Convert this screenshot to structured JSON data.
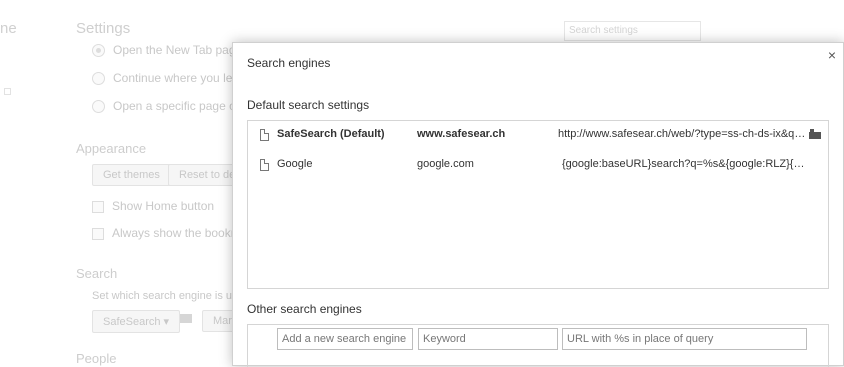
{
  "background": {
    "partial_left_text": "ne",
    "settings_heading": "Settings",
    "search_placeholder": "Search settings",
    "startup_options": [
      "Open the New Tab page",
      "Continue where you left o",
      "Open a specific page or se"
    ],
    "appearance_heading": "Appearance",
    "get_themes_label": "Get themes",
    "reset_label": "Reset to de",
    "show_home_label": "Show Home button",
    "bookmarks_label": "Always show the bookmar",
    "search_heading": "Search",
    "search_desc": "Set which search engine is use",
    "engine_select": "SafeSearch",
    "manage_label": "Mar",
    "people_heading": "People"
  },
  "dialog": {
    "title": "Search engines",
    "close_symbol": "×",
    "default_heading": "Default search settings",
    "default_engines": [
      {
        "name": "SafeSearch (Default)",
        "keyword": "www.safesear.ch",
        "url": "http://www.safesear.ch/web/?type=ss-ch-ds-ix&q=%s",
        "bold": true,
        "extension": true
      },
      {
        "name": "Google",
        "keyword": "google.com",
        "url": "{google:baseURL}search?q=%s&{google:RLZ}{google:originalQueryForSuggestion}",
        "bold": false,
        "extension": false
      }
    ],
    "other_heading": "Other search engines",
    "add_name_placeholder": "Add a new search engine",
    "add_keyword_placeholder": "Keyword",
    "add_url_placeholder": "URL with %s in place of query"
  }
}
